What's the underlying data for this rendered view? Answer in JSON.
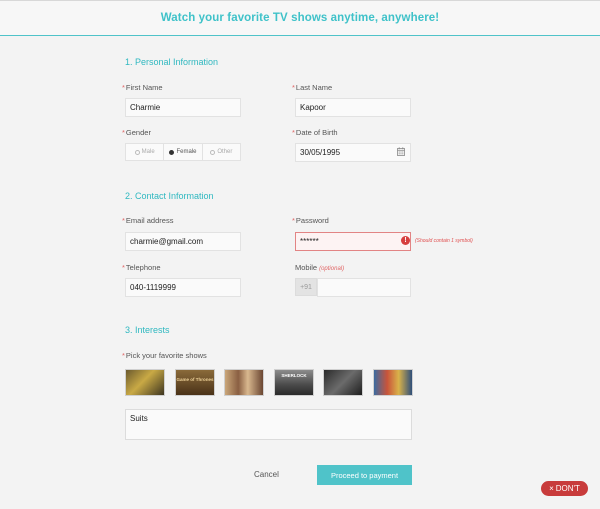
{
  "header": {
    "title": "Watch your favorite TV shows anytime, anywhere!"
  },
  "sections": {
    "personal": "1. Personal Information",
    "contact": "2. Contact Information",
    "interests": "3. Interests"
  },
  "personal": {
    "first_name": {
      "label": "First Name",
      "value": "Charmie"
    },
    "last_name": {
      "label": "Last Name",
      "value": "Kapoor"
    },
    "gender": {
      "label": "Gender",
      "options": [
        "Male",
        "Female",
        "Other"
      ],
      "selected": "Female"
    },
    "dob": {
      "label": "Date of Birth",
      "value": "30/05/1995"
    }
  },
  "contact": {
    "email": {
      "label": "Email address",
      "value": "charmie@gmail.com"
    },
    "password": {
      "label": "Password",
      "value": "******",
      "error": "(Should contain 1 symbol)"
    },
    "telephone": {
      "label": "Telephone",
      "value": "040-1119999"
    },
    "mobile": {
      "label": "Mobile",
      "optional": "(optional)",
      "prefix": "+91",
      "value": ""
    }
  },
  "interests": {
    "label": "Pick your favorite shows",
    "shows": [
      {
        "name": "show-1",
        "caption": ""
      },
      {
        "name": "show-2",
        "caption": "Game of Thrones"
      },
      {
        "name": "show-3",
        "caption": ""
      },
      {
        "name": "show-4",
        "caption": "SHERLOCK"
      },
      {
        "name": "show-5",
        "caption": ""
      },
      {
        "name": "show-6",
        "caption": ""
      }
    ],
    "selected_text": "Suits"
  },
  "actions": {
    "cancel": "Cancel",
    "proceed": "Proceed to payment"
  },
  "badge": {
    "icon": "×",
    "text": "DON'T"
  },
  "colors": {
    "accent": "#4fc3c9",
    "error": "#d63f3f",
    "badge": "#c83b3b"
  }
}
